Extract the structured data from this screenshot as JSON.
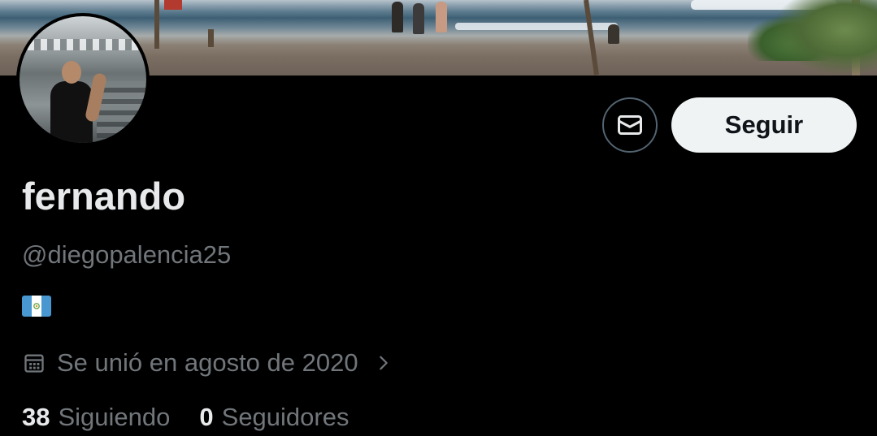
{
  "profile": {
    "display_name": "fernando",
    "handle": "@diegopalencia25",
    "bio_flag": "Guatemala flag emoji",
    "joined_text": "Se unió en agosto de 2020",
    "following_count": "38",
    "following_label": "Siguiendo",
    "followers_count": "0",
    "followers_label": "Seguidores"
  },
  "actions": {
    "message_icon": "envelope-icon",
    "follow_label": "Seguir"
  },
  "icons": {
    "calendar": "calendar-icon",
    "chevron": "chevron-right-icon"
  },
  "colors": {
    "background": "#000000",
    "primary_text": "#e7e9ea",
    "secondary_text": "#71767b",
    "button_bg": "#eff3f4",
    "button_text": "#0f1419",
    "border": "#536471"
  }
}
